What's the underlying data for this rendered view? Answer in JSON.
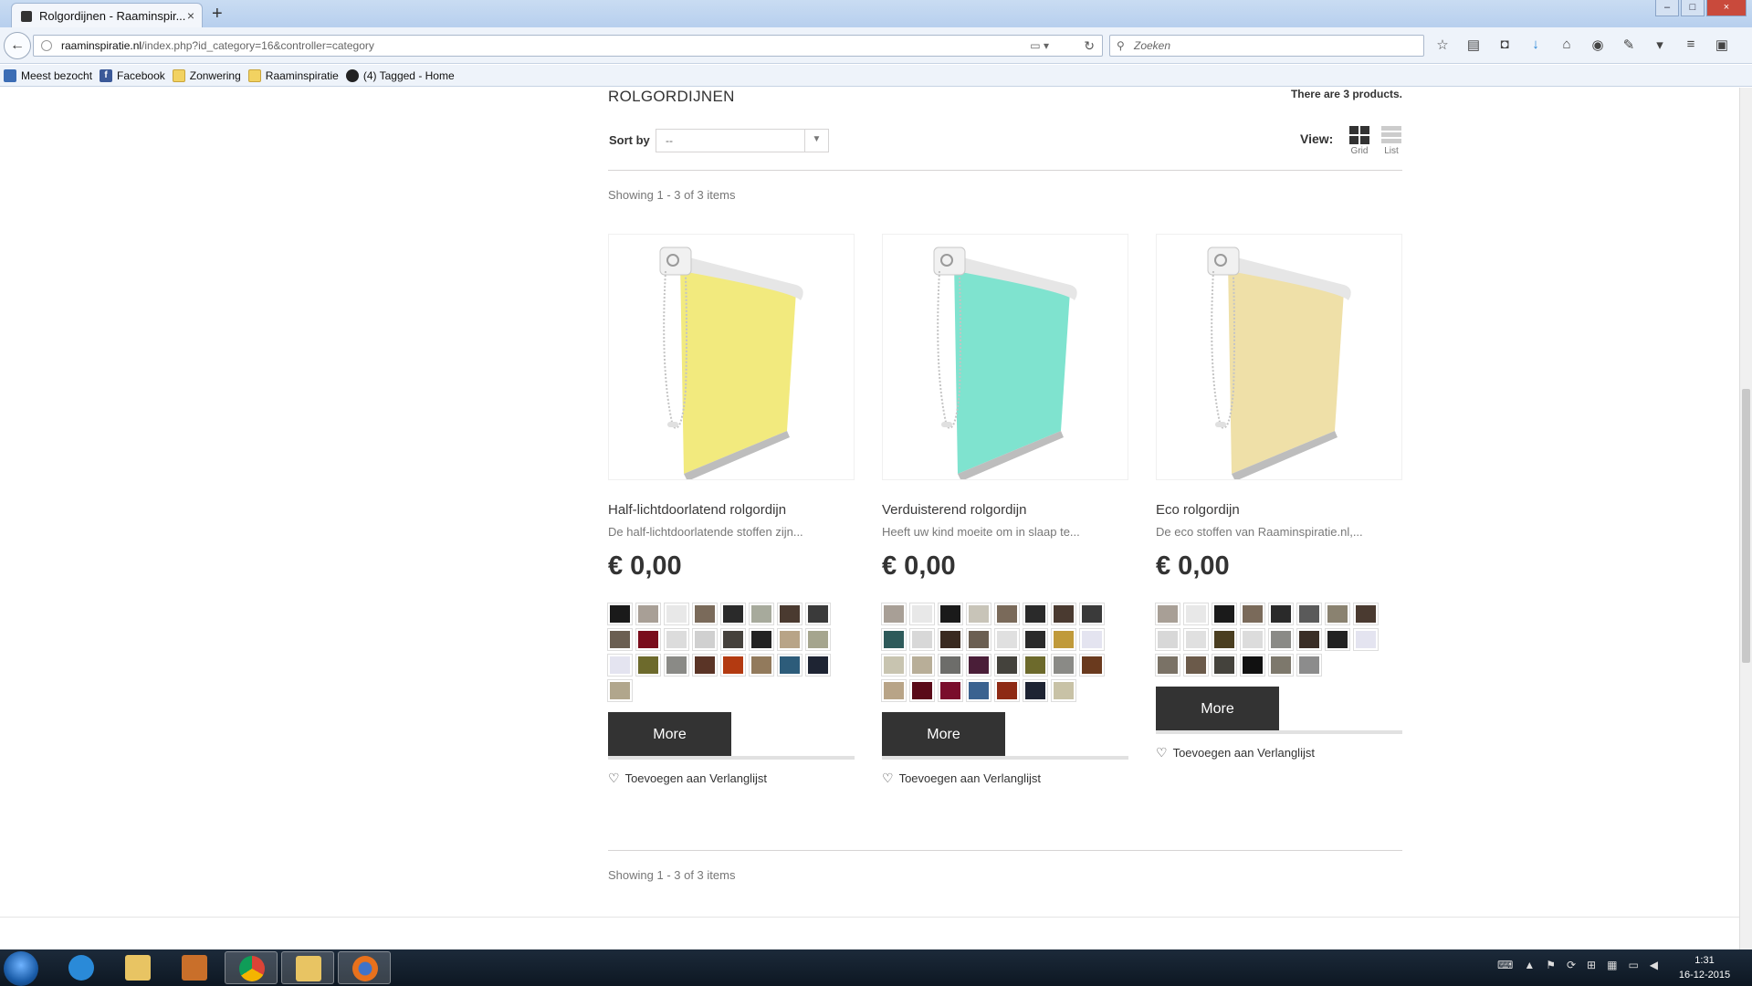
{
  "browser": {
    "tab_title": "Rolgordijnen - Raaminspir...",
    "tab_close": "×",
    "new_tab": "+",
    "url_host": "raaminspiratie.nl",
    "url_path": "/index.php?id_category=16&controller=category",
    "search_placeholder": "Zoeken",
    "bookmarks": [
      "Meest bezocht",
      "Facebook",
      "Zonwering",
      "Raaminspiratie",
      "(4) Tagged - Home"
    ]
  },
  "category": {
    "title": "ROLGORDIJNEN",
    "product_count": "There are 3 products.",
    "sort_label": "Sort by",
    "sort_value": "--",
    "view_label": "View:",
    "view_grid": "Grid",
    "view_list": "List",
    "showing_top": "Showing 1 - 3 of 3 items",
    "showing_bottom": "Showing 1 - 3 of 3 items"
  },
  "products": [
    {
      "name": "Half-lichtdoorlatend rolgordijn",
      "description": "De half-lichtdoorlatende stoffen zijn...",
      "price": "€ 0,00",
      "more": "More",
      "wishlist": "Toevoegen aan Verlanglijst",
      "fabric_color": "#f2ea7e",
      "swatches": [
        "#1a1a1a",
        "#a89f96",
        "#e8e8e8",
        "#7a6a5a",
        "#2a2a2a",
        "#a7aa9c",
        "#4a3a30",
        "#3a3a3a",
        "#6b5f52",
        "#7a0d1c",
        "#dcdcdc",
        "#d0d0d0",
        "#45413c",
        "#222222",
        "#b8a487",
        "#a5a58e",
        "#e4e4f0",
        "#6d6a2c",
        "#8a8a86",
        "#5a3426",
        "#b33a11",
        "#927a5c",
        "#2d5c7a",
        "#1e2433",
        "#b1a68c"
      ]
    },
    {
      "name": "Verduisterend rolgordijn",
      "description": "Heeft uw kind moeite om in slaap te...",
      "price": "€ 0,00",
      "more": "More",
      "wishlist": "Toevoegen aan Verlanglijst",
      "fabric_color": "#7fe3cf",
      "swatches": [
        "#a89f96",
        "#e8e8e8",
        "#1a1a1a",
        "#c8c4b8",
        "#7a6a5a",
        "#2a2a2a",
        "#4a3a30",
        "#3a3a3a",
        "#2e5a5a",
        "#d8d8d8",
        "#3a2a20",
        "#6b5f52",
        "#e0e0e0",
        "#2a2a2a",
        "#c09a3a",
        "#e4e4f0",
        "#c8c4b0",
        "#b8ae98",
        "#6d6d6a",
        "#4a1e38",
        "#44423c",
        "#6d6a2c",
        "#8a8a86",
        "#6a3a1e",
        "#b8a487",
        "#5a0a18",
        "#7a0d2c",
        "#3a6290",
        "#8e2a14",
        "#1e2433",
        "#c8c2a6"
      ]
    },
    {
      "name": "Eco rolgordijn",
      "description": "De eco stoffen van Raaminspiratie.nl,...",
      "price": "€ 0,00",
      "more": "More",
      "wishlist": "Toevoegen aan Verlanglijst",
      "fabric_color": "#efe0a8",
      "swatches": [
        "#a89f96",
        "#e8e8e8",
        "#1a1a1a",
        "#7a6a5a",
        "#2a2a2a",
        "#5a5a5a",
        "#8a8270",
        "#4a3a30",
        "#d8d8d8",
        "#e0e0e0",
        "#4a3e20",
        "#dcdcdc",
        "#8a8a86",
        "#3a2e26",
        "#222222",
        "#e4e4f0",
        "#7a7266",
        "#6b5a4a",
        "#44423c",
        "#111111",
        "#7d786c",
        "#8c8c8c"
      ]
    }
  ],
  "taskbar": {
    "time": "1:31",
    "date": "16-12-2015"
  }
}
